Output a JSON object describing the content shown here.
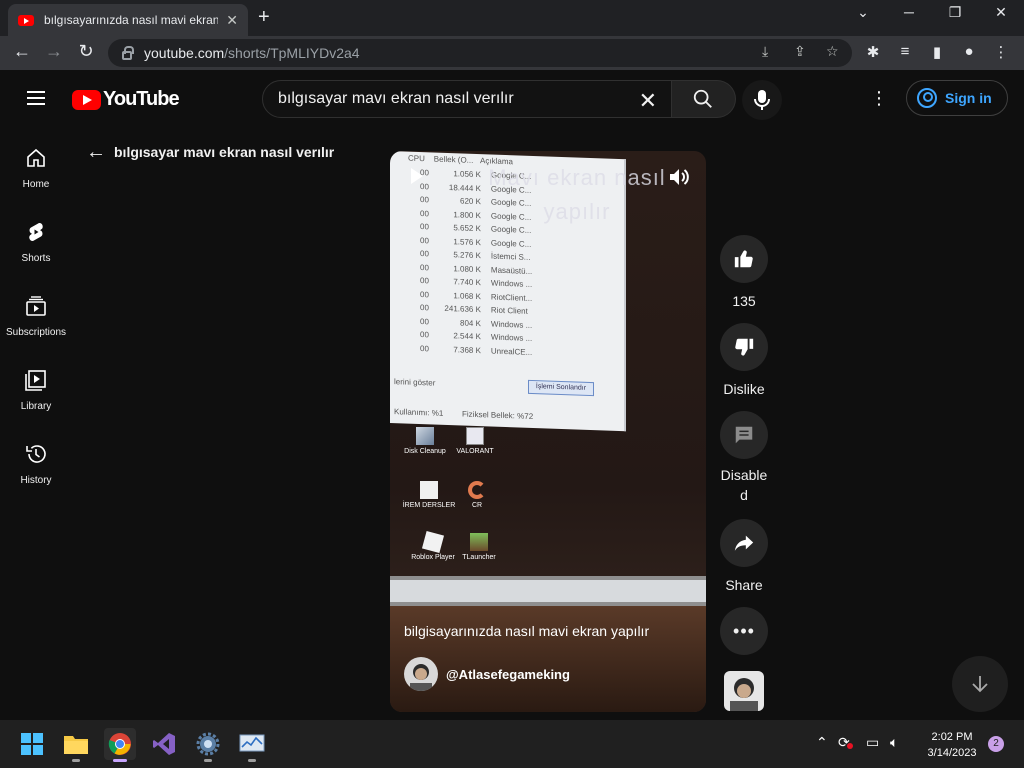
{
  "browser": {
    "tab_title": "bılgısayarınızda nasıl mavi ekran",
    "url_host": "youtube.com",
    "url_path": "/shorts/TpMLIYDv2a4"
  },
  "header": {
    "logo_text": "YouTube",
    "search_value": "bılgısayar mavı ekran nasıl verılır",
    "signin_label": "Sign in"
  },
  "sidebar": {
    "items": [
      {
        "label": "Home",
        "icon": "home-icon"
      },
      {
        "label": "Shorts",
        "icon": "shorts-icon"
      },
      {
        "label": "Subscriptions",
        "icon": "subscriptions-icon"
      },
      {
        "label": "Library",
        "icon": "library-icon"
      },
      {
        "label": "History",
        "icon": "history-icon"
      }
    ]
  },
  "page": {
    "back_title": "bılgısayar mavı ekran nasıl verılır"
  },
  "video": {
    "overlay_text_line1": "Mavı ekran nasıl",
    "overlay_text_line2": "yapılır",
    "caption": "bilgisayarınızda nasıl mavi ekran yapılır",
    "channel": "@Atlasefegameking",
    "screen": {
      "header_cols": [
        "CPU",
        "Bellek (O...",
        "Açıklama"
      ],
      "rows": [
        {
          "cpu": "00",
          "mem": "1.056 K",
          "desc": "Google C..."
        },
        {
          "cpu": "00",
          "mem": "18.444 K",
          "desc": "Google C..."
        },
        {
          "cpu": "00",
          "mem": "620 K",
          "desc": "Google C..."
        },
        {
          "cpu": "00",
          "mem": "1.800 K",
          "desc": "Google C..."
        },
        {
          "cpu": "00",
          "mem": "5.652 K",
          "desc": "Google C..."
        },
        {
          "cpu": "00",
          "mem": "1.576 K",
          "desc": "Google C..."
        },
        {
          "cpu": "00",
          "mem": "5.276 K",
          "desc": "İstemci S..."
        },
        {
          "cpu": "00",
          "mem": "1.080 K",
          "desc": "Masaüstü..."
        },
        {
          "cpu": "00",
          "mem": "7.740 K",
          "desc": "Windows ..."
        },
        {
          "cpu": "00",
          "mem": "1.068 K",
          "desc": "RiotClient..."
        },
        {
          "cpu": "00",
          "mem": "241.636 K",
          "desc": "Riot Client"
        },
        {
          "cpu": "00",
          "mem": "804 K",
          "desc": "Windows ..."
        },
        {
          "cpu": "00",
          "mem": "2.544 K",
          "desc": "Windows ..."
        },
        {
          "cpu": "00",
          "mem": "7.368 K",
          "desc": "UnrealCE..."
        }
      ],
      "show_label": "lerini göster",
      "end_button": "İşlemi Sonlandır",
      "status_left": "Kullanımı: %1",
      "status_right": "Fiziksel Bellek: %72",
      "icons": [
        {
          "label": "Disk Cleanup"
        },
        {
          "label": "VALORANT"
        },
        {
          "label": "İREM DERSLER"
        },
        {
          "label": "CR"
        },
        {
          "label": "Roblox Player"
        },
        {
          "label": "TLauncher"
        }
      ]
    }
  },
  "actions": {
    "like_count": "135",
    "dislike_label": "Dislike",
    "comments_label_1": "Disable",
    "comments_label_2": "d",
    "share_label": "Share"
  },
  "taskbar": {
    "time": "2:02 PM",
    "date": "3/14/2023",
    "notifications": "2"
  },
  "colors": {
    "youtube_red": "#ff0000",
    "link_blue": "#3ea6ff",
    "background": "#0f0f0f"
  }
}
